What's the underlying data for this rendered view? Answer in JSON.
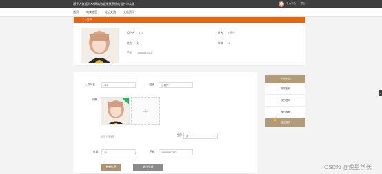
{
  "header": {
    "site_title": "基于大数据的XX网站数据采集系统的设计与实现",
    "username": "个人中心",
    "logout": "退出"
  },
  "nav": {
    "items": [
      {
        "label": "首页"
      },
      {
        "label": "电商信息"
      },
      {
        "label": "论坛交流"
      },
      {
        "label": "公告资讯"
      }
    ]
  },
  "banner": {
    "title": "个人信息"
  },
  "profile": {
    "username_label": "用户名",
    "username_value": "111",
    "name_label": "姓名",
    "name_value": "小雪柠",
    "gender_label": "性别",
    "gender_value": "女",
    "age_label": "年龄",
    "age_value": "21",
    "phone_label": "手机",
    "phone_value": "18668852321"
  },
  "form": {
    "username_label": "用户名",
    "username_value": "111",
    "name_label": "姓名",
    "name_value": "小雪柠",
    "avatar_label": "头像",
    "upload_plus": "+",
    "upload_hint": "点击上传头像",
    "gender_label": "性别",
    "gender_value": "女",
    "age_label": "年龄",
    "age_value": "21",
    "phone_label": "手机",
    "phone_value": "18668852321",
    "update_button": "更新信息",
    "logout_button": "退出登录"
  },
  "sidebar": {
    "title": "个人中心",
    "items": [
      {
        "label": "修改密码"
      },
      {
        "label": "我的发布"
      },
      {
        "label": "我的收藏"
      },
      {
        "label": "返回首页"
      }
    ]
  },
  "watermark": "CSDN @俊星学长",
  "colors": {
    "accent": "#e6650f",
    "sidebar": "#b29b78",
    "header": "#3f3f3f"
  }
}
